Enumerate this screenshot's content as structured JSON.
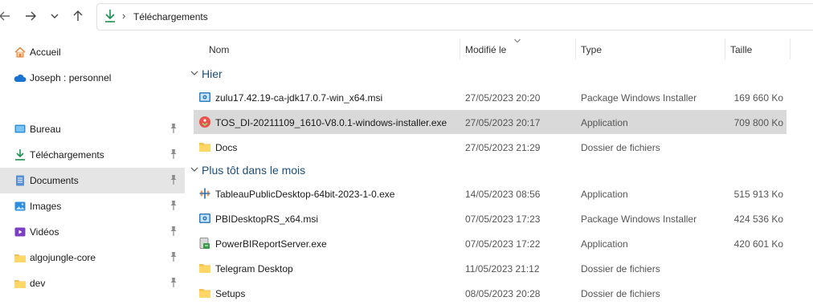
{
  "address": {
    "crumb": "Téléchargements"
  },
  "sidebar": {
    "items": [
      {
        "label": "Accueil",
        "icon": "home-icon"
      },
      {
        "label": "Joseph : personnel",
        "icon": "onedrive-cloud-icon"
      },
      {
        "label": "Bureau",
        "icon": "desktop-icon",
        "pinned": true
      },
      {
        "label": "Téléchargements",
        "icon": "download-icon",
        "pinned": true
      },
      {
        "label": "Documents",
        "icon": "documents-icon",
        "pinned": true,
        "selected": true
      },
      {
        "label": "Images",
        "icon": "images-icon",
        "pinned": true
      },
      {
        "label": "Vidéos",
        "icon": "videos-icon",
        "pinned": true
      },
      {
        "label": "algojungle-core",
        "icon": "folder-icon",
        "pinned": true
      },
      {
        "label": "dev",
        "icon": "folder-icon",
        "pinned": true
      }
    ]
  },
  "columns": {
    "name": "Nom",
    "modified": "Modifié le",
    "type": "Type",
    "size": "Taille"
  },
  "groups": [
    {
      "label": "Hier"
    },
    {
      "label": "Plus tôt dans le mois"
    }
  ],
  "files": [
    {
      "name": "zulu17.42.19-ca-jdk17.0.7-win_x64.msi",
      "date": "27/05/2023 20:20",
      "type": "Package Windows Installer",
      "size": "169 660 Ko",
      "icon": "msi-installer-icon"
    },
    {
      "name": "TOS_DI-20211109_1610-V8.0.1-windows-installer.exe",
      "date": "27/05/2023 20:17",
      "type": "Application",
      "size": "709 800 Ko",
      "icon": "talend-app-icon",
      "selected": true
    },
    {
      "name": "Docs",
      "date": "27/05/2023 21:29",
      "type": "Dossier de fichiers",
      "size": "",
      "icon": "folder-icon"
    },
    {
      "name": "TableauPublicDesktop-64bit-2023-1-0.exe",
      "date": "14/05/2023 08:56",
      "type": "Application",
      "size": "515 913 Ko",
      "icon": "tableau-app-icon"
    },
    {
      "name": "PBIDesktopRS_x64.msi",
      "date": "07/05/2023 17:23",
      "type": "Package Windows Installer",
      "size": "424 536 Ko",
      "icon": "msi-installer-icon"
    },
    {
      "name": "PowerBIReportServer.exe",
      "date": "07/05/2023 17:22",
      "type": "Application",
      "size": "420 601 Ko",
      "icon": "setup-app-icon"
    },
    {
      "name": "Telegram Desktop",
      "date": "11/05/2023 21:12",
      "type": "Dossier de fichiers",
      "size": "",
      "icon": "folder-icon"
    },
    {
      "name": "Setups",
      "date": "08/05/2023 20:28",
      "type": "Dossier de fichiers",
      "size": "",
      "icon": "folder-icon"
    }
  ],
  "colors": {
    "accent_green": "#1e8f4e",
    "folder": "#f4c04e",
    "group_text": "#1e4e79",
    "selection": "#d9d9d9"
  }
}
